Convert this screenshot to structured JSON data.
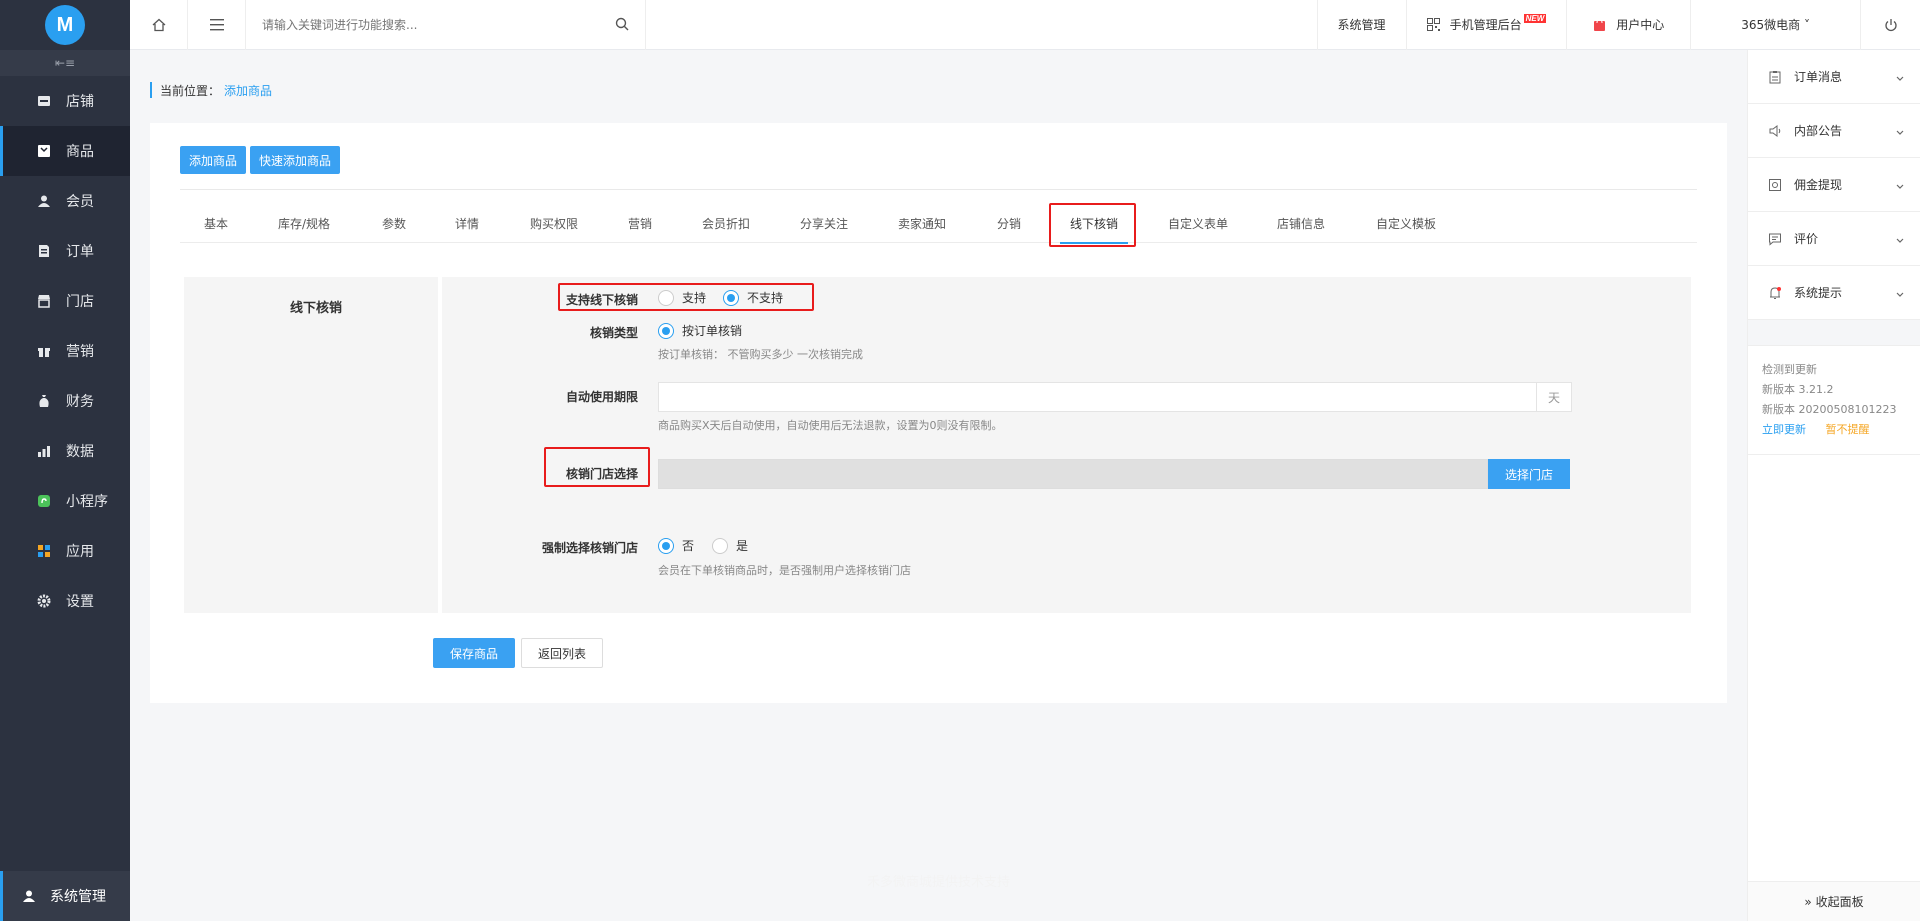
{
  "logo": {
    "letter": "M"
  },
  "sidebar": {
    "collapse": "⇤≡",
    "items": [
      {
        "label": "店铺"
      },
      {
        "label": "商品"
      },
      {
        "label": "会员"
      },
      {
        "label": "订单"
      },
      {
        "label": "门店"
      },
      {
        "label": "营销"
      },
      {
        "label": "财务"
      },
      {
        "label": "数据"
      },
      {
        "label": "小程序"
      },
      {
        "label": "应用"
      },
      {
        "label": "设置"
      }
    ],
    "bottom": "系统管理"
  },
  "topbar": {
    "search_placeholder": "请输入关键词进行功能搜索...",
    "links": {
      "system": "系统管理",
      "mobile": "手机管理后台",
      "new_badge": "NEW",
      "user_center": "用户中心",
      "shop": "365微电商 ˅"
    }
  },
  "breadcrumb": {
    "prefix": "当前位置：",
    "current": "添加商品"
  },
  "actions": {
    "add": "添加商品",
    "quick_add": "快速添加商品"
  },
  "tabs": [
    "基本",
    "库存/规格",
    "参数",
    "详情",
    "购买权限",
    "营销",
    "会员折扣",
    "分享关注",
    "卖家通知",
    "分销",
    "线下核销",
    "自定义表单",
    "店铺信息",
    "自定义模板"
  ],
  "form": {
    "section_title": "线下核销",
    "support": {
      "label": "支持线下核销",
      "opt_yes": "支持",
      "opt_no": "不支持"
    },
    "type": {
      "label": "核销类型",
      "option": "按订单核销",
      "help": "按订单核销： 不管购买多少 一次核销完成"
    },
    "auto": {
      "label": "自动使用期限",
      "value": "",
      "suffix": "天",
      "help": "商品购买X天后自动使用，自动使用后无法退款，设置为0则没有限制。"
    },
    "store": {
      "label": "核销门店选择",
      "button": "选择门店"
    },
    "force": {
      "label": "强制选择核销门店",
      "opt_no": "否",
      "opt_yes": "是",
      "help": "会员在下单核销商品时，是否强制用户选择核销门店"
    }
  },
  "buttons": {
    "save": "保存商品",
    "back": "返回列表"
  },
  "footer": "禾多微商城提供技术支持",
  "right_panel": {
    "items": [
      {
        "label": "订单消息"
      },
      {
        "label": "内部公告"
      },
      {
        "label": "佣金提现"
      },
      {
        "label": "评价"
      },
      {
        "label": "系统提示"
      }
    ],
    "update": {
      "line1": "检测到更新",
      "line2": "新版本 3.21.2",
      "line3": "新版本 20200508101223",
      "update_now": "立即更新",
      "remind_later": "暂不提醒"
    },
    "collapse": "» 收起面板"
  },
  "colors": {
    "primary": "#2a9ff0",
    "sidebar": "#2c3240",
    "highlight": "#e81c1c",
    "warning": "#f5a623"
  }
}
